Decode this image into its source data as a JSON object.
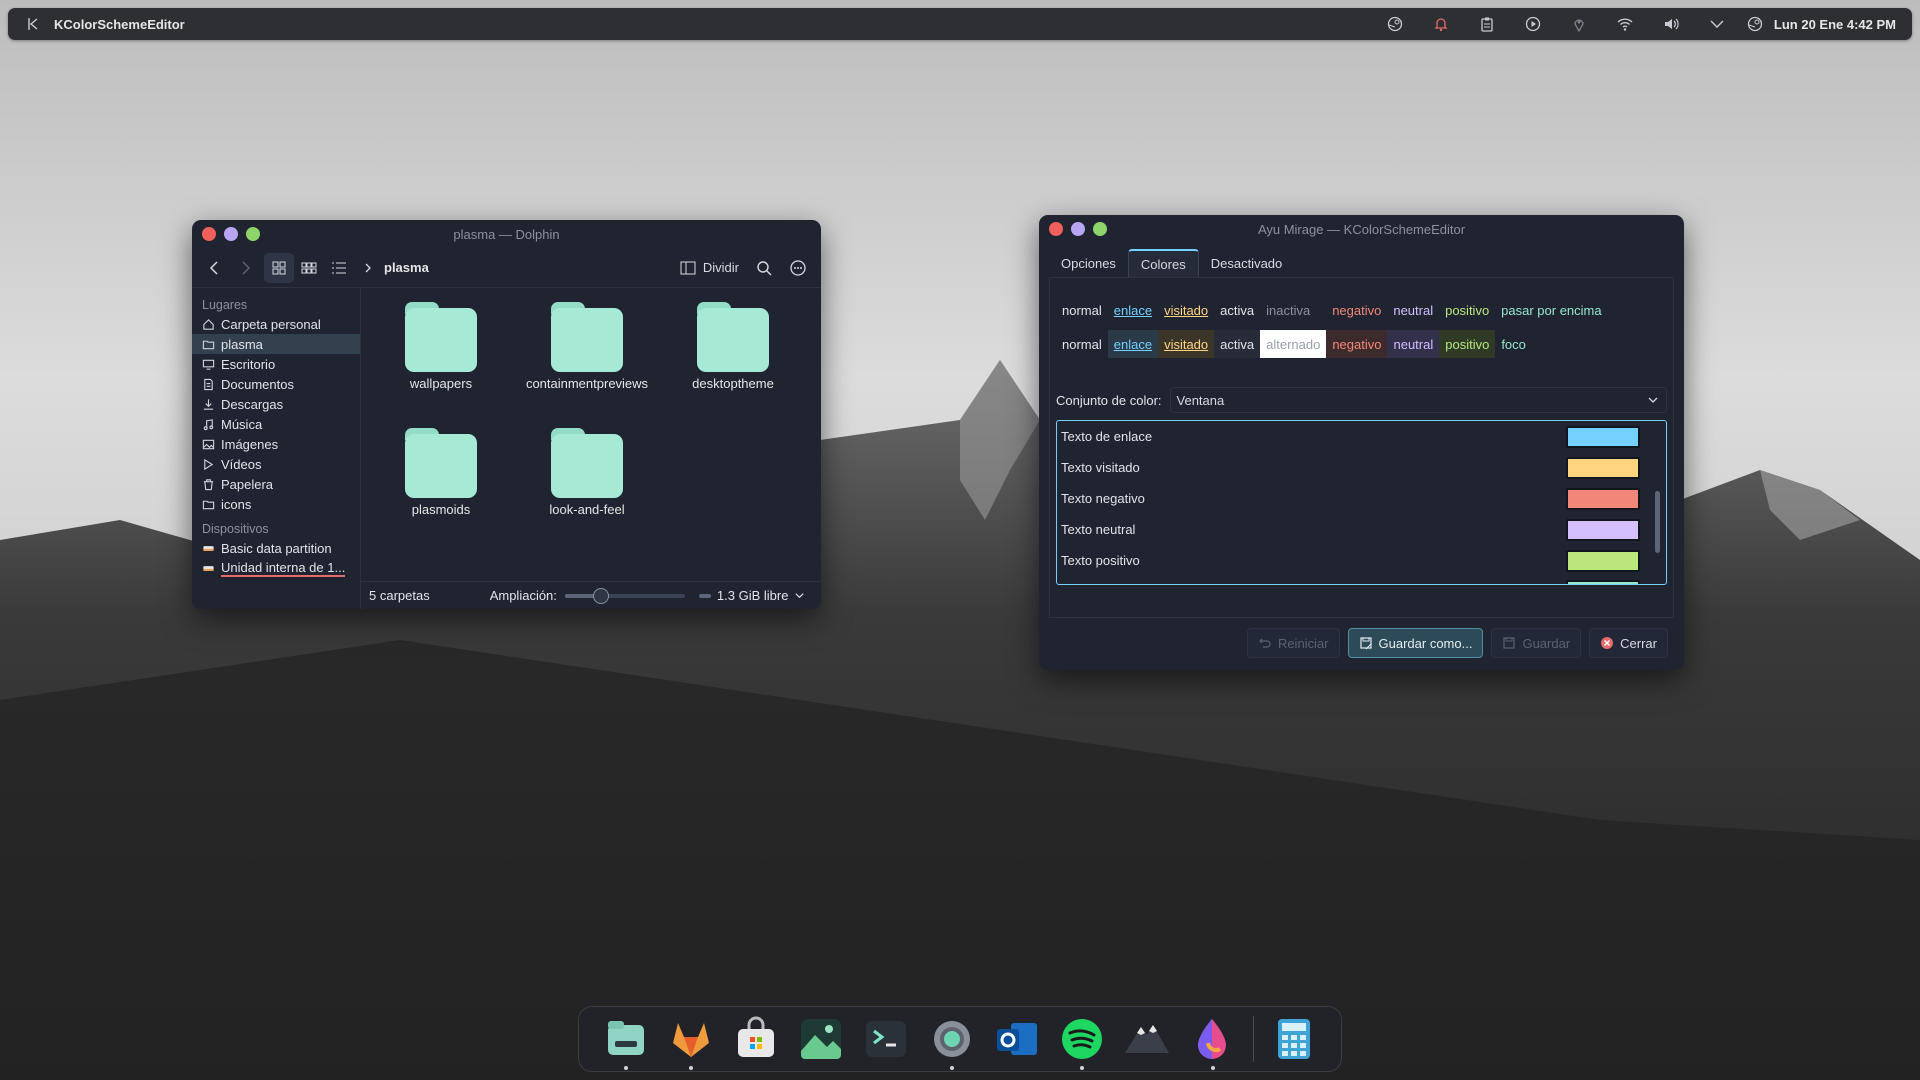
{
  "topbar": {
    "app_title": "KColorSchemeEditor",
    "clock": "Lun 20 Ene  4:42 PM",
    "tray_icons": [
      "steam-icon",
      "notification-bell-icon",
      "clipboard-icon",
      "media-play-icon",
      "location-icon",
      "wifi-icon",
      "volume-icon",
      "chevron-down-icon",
      "steam-icon"
    ]
  },
  "dolphin": {
    "title": "plasma — Dolphin",
    "breadcrumb_current": "plasma",
    "split_label": "Dividir",
    "places_header": "Lugares",
    "places": [
      {
        "label": "Carpeta personal",
        "icon": "home-icon"
      },
      {
        "label": "plasma",
        "icon": "folder-icon",
        "selected": true
      },
      {
        "label": "Escritorio",
        "icon": "desktop-icon"
      },
      {
        "label": "Documentos",
        "icon": "document-icon"
      },
      {
        "label": "Descargas",
        "icon": "download-icon"
      },
      {
        "label": "Música",
        "icon": "music-icon"
      },
      {
        "label": "Imágenes",
        "icon": "image-icon"
      },
      {
        "label": "Vídeos",
        "icon": "video-icon"
      },
      {
        "label": "Papelera",
        "icon": "trash-icon"
      },
      {
        "label": "icons",
        "icon": "folder-icon"
      }
    ],
    "devices_header": "Dispositivos",
    "devices": [
      {
        "label": "Basic data partition",
        "icon": "drive-icon"
      },
      {
        "label": "Unidad interna de 1...",
        "icon": "drive-icon"
      }
    ],
    "folders": [
      "wallpapers",
      "containmentpreviews",
      "desktoptheme",
      "plasmoids",
      "look-and-feel"
    ],
    "status_count": "5 carpetas",
    "zoom_label": "Ampliación:",
    "zoom_level": 0.3,
    "free_space": "1.3 GiB libre"
  },
  "kcs": {
    "title": "Ayu Mirage — KColorSchemeEditor",
    "tabs": [
      "Opciones",
      "Colores",
      "Desactivado"
    ],
    "active_tab": "Colores",
    "preview_row1": {
      "normal": "normal",
      "enlace": "enlace",
      "visitado": "visitado",
      "activa": "activa",
      "inactiva": "inactiva",
      "negativo": "negativo",
      "neutral": "neutral",
      "positivo": "positivo",
      "hover": "pasar por encima"
    },
    "preview_row2": {
      "normal": "normal",
      "enlace": "enlace",
      "visitado": "visitado",
      "activa": "activa",
      "alternado": "alternado",
      "negativo": "negativo",
      "neutral": "neutral",
      "positivo": "positivo",
      "foco": "foco"
    },
    "color_set_label": "Conjunto de color:",
    "color_set_value": "Ventana",
    "color_rows": [
      {
        "label": "Texto de enlace",
        "color": "#73d0ff"
      },
      {
        "label": "Texto visitado",
        "color": "#ffd580"
      },
      {
        "label": "Texto negativo",
        "color": "#f28779"
      },
      {
        "label": "Texto neutral",
        "color": "#d4bfff"
      },
      {
        "label": "Texto positivo",
        "color": "#bae67e"
      }
    ],
    "buttons": {
      "reset": "Reiniciar",
      "save_as": "Guardar como...",
      "save": "Guardar",
      "close": "Cerrar"
    }
  },
  "colors": {
    "link": "#73d0ff",
    "visited": "#ffd580",
    "negative": "#f28779",
    "neutral": "#d4bfff",
    "positive": "#bae67e",
    "hover": "#95e6cb",
    "folder": "#a6ead6"
  },
  "dock": {
    "apps": [
      {
        "name": "files-app-icon",
        "running": true
      },
      {
        "name": "gitlab-fox-icon",
        "running": true
      },
      {
        "name": "store-bag-icon",
        "running": false
      },
      {
        "name": "image-viewer-icon",
        "running": false
      },
      {
        "name": "terminal-icon",
        "running": false
      },
      {
        "name": "settings-gear-icon",
        "running": true
      },
      {
        "name": "outlook-icon",
        "running": false
      },
      {
        "name": "spotify-icon",
        "running": true
      },
      {
        "name": "mountain-app-icon",
        "running": false
      },
      {
        "name": "paint-drop-icon",
        "running": true
      },
      {
        "name": "calculator-icon",
        "running": false
      }
    ]
  }
}
